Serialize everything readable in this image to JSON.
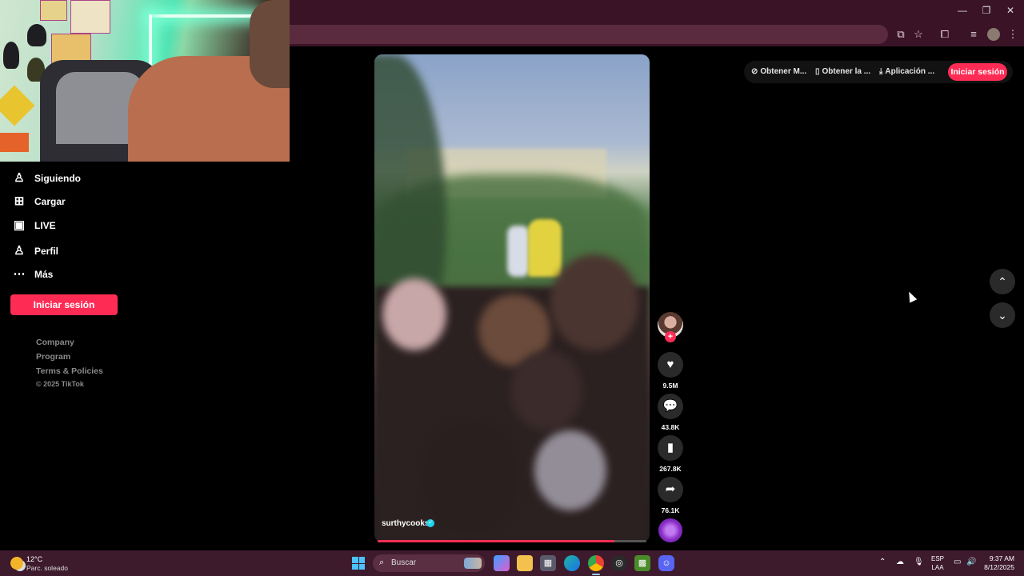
{
  "browser": {
    "window_controls": {
      "minimize": "—",
      "restore": "❐",
      "close": "✕"
    },
    "toolbar_icons": [
      "install-app-icon",
      "star-icon",
      "extensions-icon",
      "media-icon",
      "profile-icon",
      "menu-icon"
    ]
  },
  "sidebar": {
    "items": [
      {
        "label": "Siguiendo",
        "icon": "following-icon"
      },
      {
        "label": "Cargar",
        "icon": "upload-icon"
      },
      {
        "label": "LIVE",
        "icon": "live-icon"
      },
      {
        "label": "Perfil",
        "icon": "profile-icon"
      },
      {
        "label": "Más",
        "icon": "more-icon"
      }
    ],
    "login_label": "Iniciar sesión",
    "footer_links": [
      "Company",
      "Program",
      "Terms & Policies"
    ],
    "copyright": "© 2025 TikTok"
  },
  "header": {
    "links": [
      {
        "label": "Obtener M...",
        "icon": "coin-icon"
      },
      {
        "label": "Obtener la ...",
        "icon": "phone-icon"
      },
      {
        "label": "Aplicación ...",
        "icon": "download-icon"
      }
    ],
    "login_label": "Iniciar sesión"
  },
  "video": {
    "author": "surthycooks",
    "progress": 0.88,
    "actions": {
      "likes": "9.5M",
      "comments": "43.8K",
      "saves": "267.8K",
      "shares": "76.1K"
    }
  },
  "taskbar": {
    "weather": {
      "temp": "12°C",
      "desc": "Parc. soleado"
    },
    "search_placeholder": "Buscar",
    "lang_top": "ESP",
    "lang_bottom": "LAA",
    "time": "9:37 AM",
    "date": "8/12/2025"
  },
  "colors": {
    "accent": "#fe2c55",
    "chrome": "#3a1426",
    "taskbar": "#3d1a2c"
  }
}
